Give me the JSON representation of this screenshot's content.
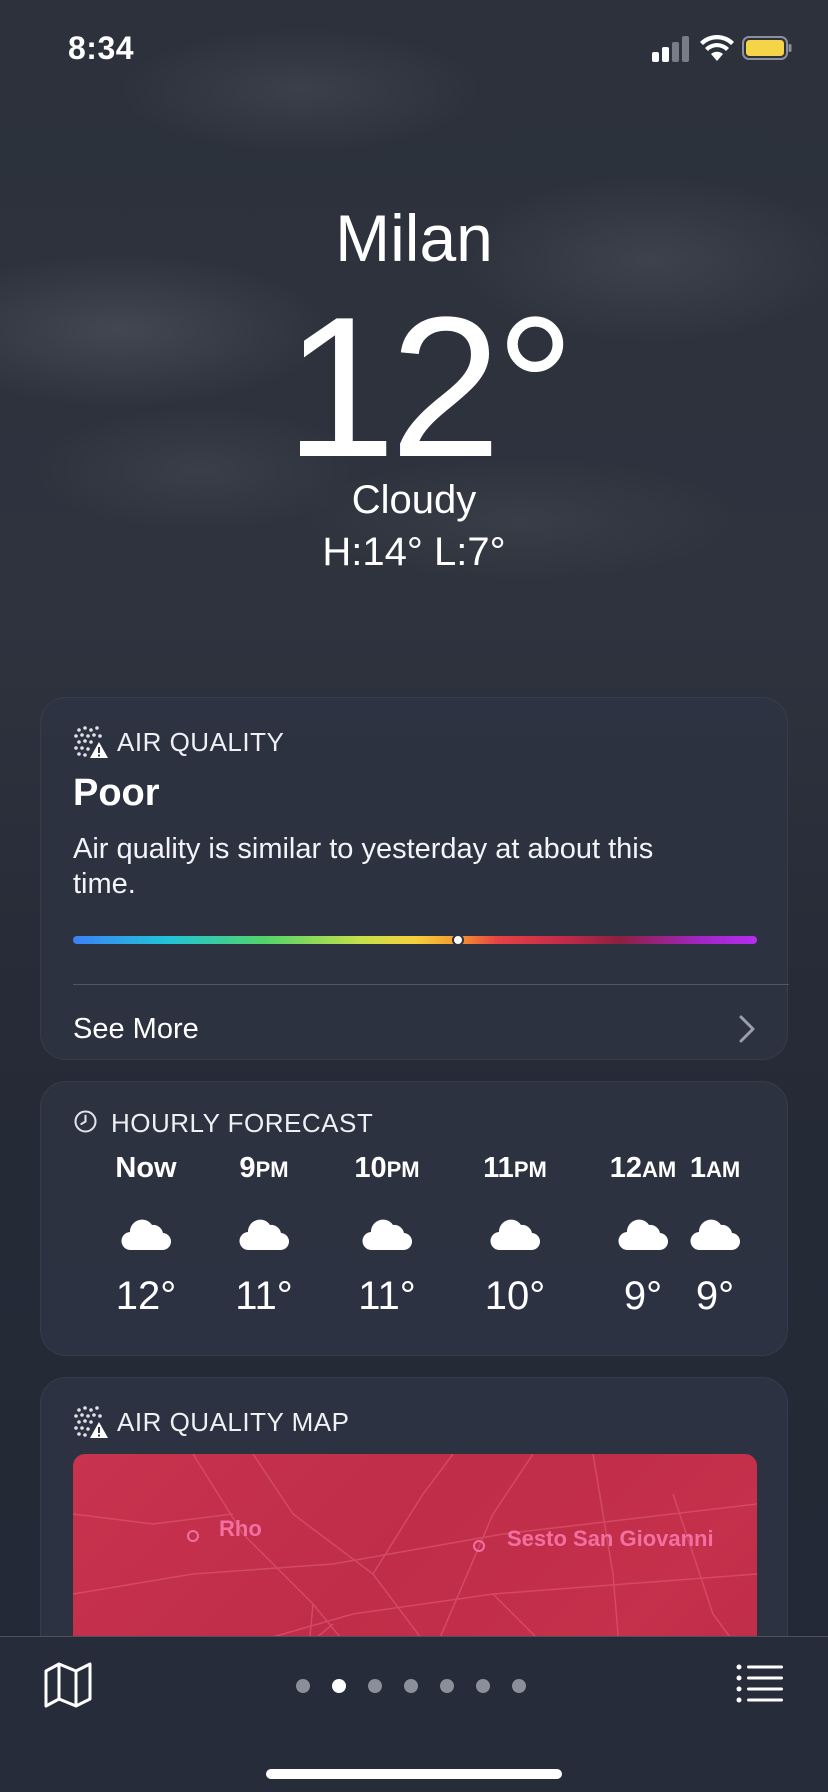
{
  "status_bar": {
    "time": "8:34"
  },
  "location": {
    "city": "Milan",
    "temperature": "12°",
    "condition": "Cloudy",
    "high_low": "H:14°  L:7°"
  },
  "air_quality": {
    "title": "AIR QUALITY",
    "icon": "air-quality-icon",
    "level": "Poor",
    "description": "Air quality is similar to yesterday at about this time.",
    "scale_position": 0.566,
    "see_more_label": "See More"
  },
  "hourly_forecast": {
    "title": "HOURLY FORECAST",
    "icon": "clock-icon",
    "hours": [
      {
        "time": "Now",
        "suffix": "",
        "icon": "cloud-icon",
        "temp": "12°"
      },
      {
        "time": "9",
        "suffix": "PM",
        "icon": "cloud-icon",
        "temp": "11°"
      },
      {
        "time": "10",
        "suffix": "PM",
        "icon": "cloud-icon",
        "temp": "11°"
      },
      {
        "time": "11",
        "suffix": "PM",
        "icon": "cloud-icon",
        "temp": "10°"
      },
      {
        "time": "12",
        "suffix": "AM",
        "icon": "cloud-icon",
        "temp": "9°"
      },
      {
        "time": "1",
        "suffix": "AM",
        "icon": "cloud-icon",
        "temp": "9°"
      }
    ]
  },
  "air_quality_map": {
    "title": "AIR QUALITY MAP",
    "icon": "air-quality-icon",
    "places": [
      "Rho",
      "Sesto San Giovanni"
    ],
    "map_color": "#c8334e",
    "label_color": "#f26fa2"
  },
  "bottom_bar": {
    "page_count": 7,
    "active_page": 2,
    "left_icon": "map-icon",
    "right_icon": "list-icon"
  }
}
